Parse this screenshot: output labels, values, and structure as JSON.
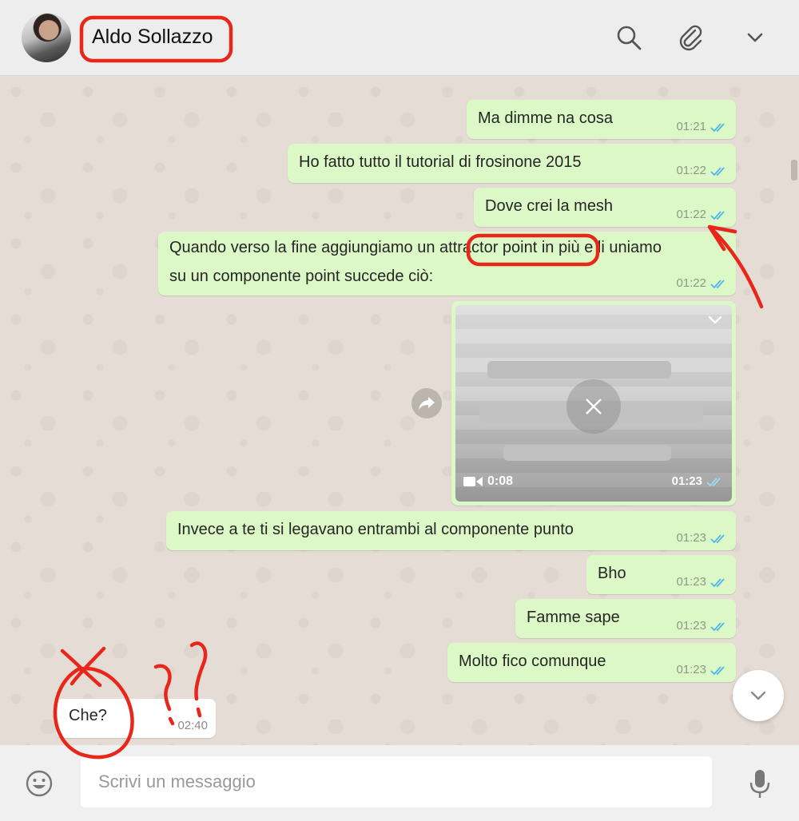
{
  "header": {
    "contact_name": "Aldo Sollazzo"
  },
  "messages": [
    {
      "text": "Ma dimme na cosa",
      "time": "01:21"
    },
    {
      "text": "Ho fatto tutto il tutorial di frosinone 2015",
      "time": "01:22"
    },
    {
      "text": "Dove crei la mesh",
      "time": "01:22"
    },
    {
      "text": "Quando verso la fine aggiungiamo un attractor point in più e li uniamo su un componente point succede ciò:",
      "time": "01:22"
    },
    {
      "text": "Invece a te ti si legavano entrambi al componente punto",
      "time": "01:23"
    },
    {
      "text": "Bho",
      "time": "01:23"
    },
    {
      "text": "Famme sape",
      "time": "01:23"
    },
    {
      "text": "Molto fico comunque",
      "time": "01:23"
    }
  ],
  "video": {
    "duration": "0:08",
    "time": "01:23"
  },
  "incoming": {
    "text": "Che?",
    "time": "02:40"
  },
  "composer": {
    "placeholder": "Scrivi un messaggio"
  },
  "colors": {
    "outgoing_bubble": "#dcf8c6",
    "incoming_bubble": "#ffffff",
    "read_ticks": "#4fb6ec",
    "annotation_red": "#e8271b"
  }
}
